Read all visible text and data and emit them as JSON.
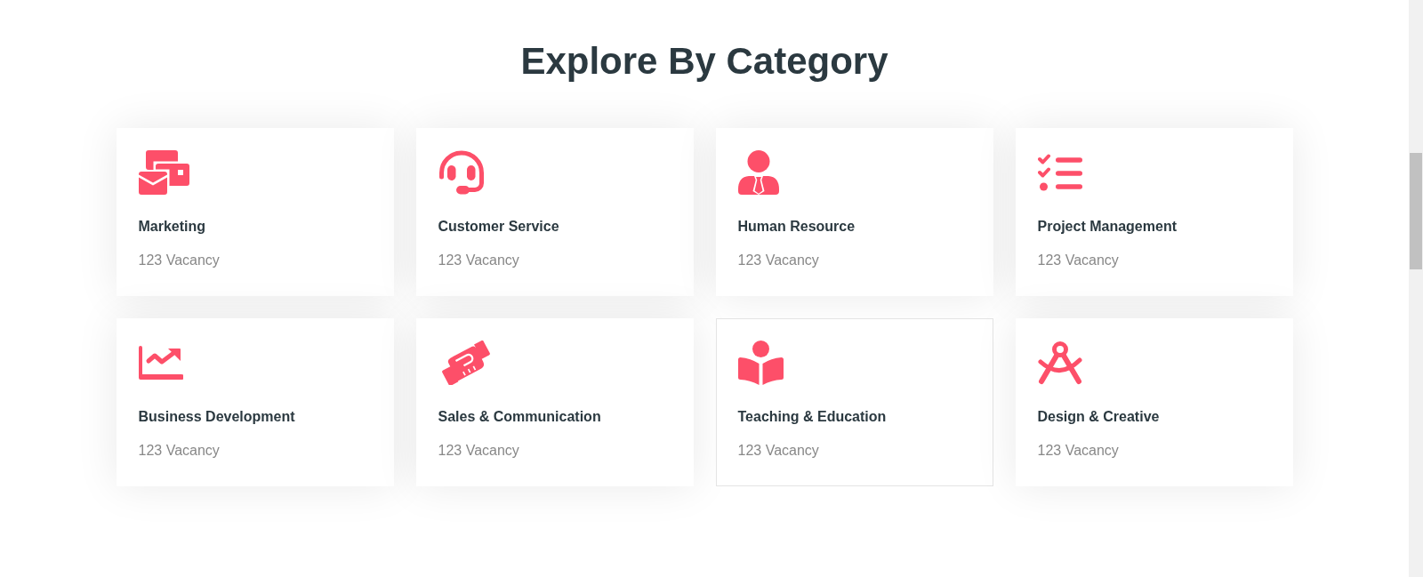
{
  "heading": "Explore By Category",
  "categories": [
    {
      "title": "Marketing",
      "count": "123 Vacancy",
      "hovered": false
    },
    {
      "title": "Customer Service",
      "count": "123 Vacancy",
      "hovered": false
    },
    {
      "title": "Human Resource",
      "count": "123 Vacancy",
      "hovered": false
    },
    {
      "title": "Project Management",
      "count": "123 Vacancy",
      "hovered": false
    },
    {
      "title": "Business Development",
      "count": "123 Vacancy",
      "hovered": false
    },
    {
      "title": "Sales & Communication",
      "count": "123 Vacancy",
      "hovered": false
    },
    {
      "title": "Teaching & Education",
      "count": "123 Vacancy",
      "hovered": true
    },
    {
      "title": "Design & Creative",
      "count": "123 Vacancy",
      "hovered": false
    }
  ]
}
